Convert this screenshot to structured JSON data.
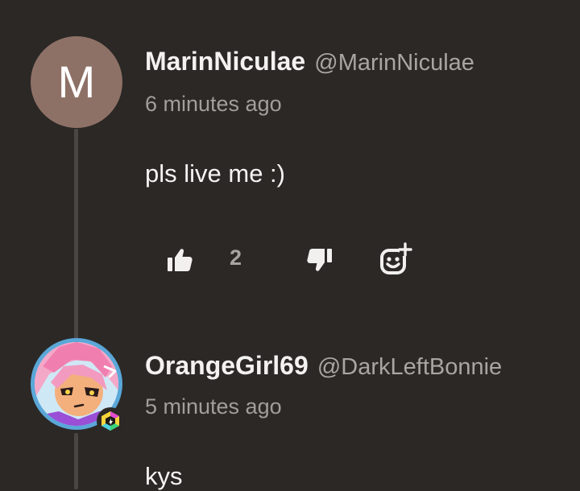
{
  "comments": [
    {
      "avatar_letter": "M",
      "display_name": "MarinNiculae",
      "handle": "@MarinNiculae",
      "timestamp": "6 minutes ago",
      "text": "pls live me :)",
      "like_count": "2",
      "avatar_color": "#8e7166"
    },
    {
      "display_name": "OrangeGirl69",
      "handle": "@DarkLeftBonnie",
      "timestamp": "5 minutes ago",
      "text": "kys",
      "avatar_ring_color": "#5aa7d8"
    }
  ],
  "icons": {
    "like": "thumbs-up-icon",
    "dislike": "thumbs-down-icon",
    "react": "add-reaction-icon",
    "badge": "creator-badge-icon"
  },
  "colors": {
    "background": "#2b2826",
    "thread_line": "#4a4643",
    "secondary_text": "#a9a5a1"
  }
}
